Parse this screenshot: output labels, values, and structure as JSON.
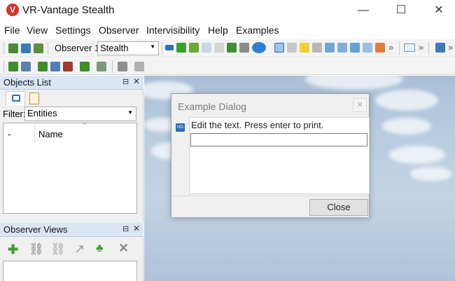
{
  "app": {
    "title": "VR-Vantage Stealth",
    "icon_glyph": "V",
    "brand_color": "#d9322a"
  },
  "window_controls": {
    "minimize": "—",
    "maximize": "☐",
    "close": "✕"
  },
  "menu": [
    "File",
    "View",
    "Settings",
    "Observer",
    "Intervisibility",
    "Help",
    "Examples"
  ],
  "toolbar": {
    "observer_label": "Observer 1",
    "observer_mode": "Stealth",
    "overflow": "»"
  },
  "objects_panel": {
    "title": "Objects List",
    "filter_label": "Filter:",
    "filter_value": "Entities",
    "columns": [
      "-",
      "Name"
    ]
  },
  "observer_views_panel": {
    "title": "Observer Views"
  },
  "dialog": {
    "title": "Example Dialog",
    "prompt": "Edit the text. Press enter to print.",
    "input_value": "",
    "close_label": "Close",
    "icon_text": "HD"
  },
  "panel_controls": {
    "pin": "⊟",
    "close": "✕"
  },
  "colors": {
    "panel_header": "#dbe6f4",
    "sky": "#b9cde0",
    "green": "#3aa02b"
  }
}
